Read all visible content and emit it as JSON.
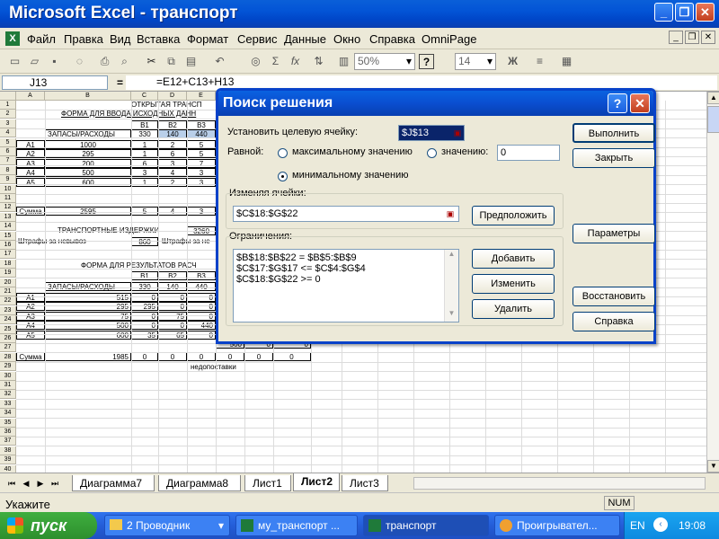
{
  "window": {
    "title": "Microsoft Excel - транспорт"
  },
  "menu": {
    "items": [
      "Файл",
      "Правка",
      "Вид",
      "Вставка",
      "Формат",
      "Сервис",
      "Данные",
      "Окно",
      "Справка",
      "OmniPage"
    ]
  },
  "toolbar": {
    "zoom": "50%",
    "font_size": "14",
    "bold": "Ж",
    "sigma": "Σ",
    "fx": "fx"
  },
  "formula_bar": {
    "name_box": "J13",
    "eq": "=",
    "formula": "=E12+C13+H13"
  },
  "sheet": {
    "columns": [
      "A",
      "B",
      "C",
      "D",
      "E"
    ],
    "rows": [
      "1",
      "2",
      "3",
      "4",
      "5",
      "6",
      "7",
      "8",
      "9",
      "10",
      "11",
      "12",
      "13",
      "14",
      "15",
      "16",
      "17",
      "18",
      "19",
      "20",
      "21",
      "22",
      "23",
      "24",
      "25",
      "26",
      "27",
      "28",
      "29",
      "30",
      "31",
      "32",
      "33",
      "34",
      "35",
      "36",
      "37",
      "38",
      "39",
      "40"
    ],
    "t1": "ОТКРЫТАЯ ТРАНСП",
    "t2": "ФОРМА ДЛЯ ВВОДА ИСХОДНЫХ ДАНН",
    "hdr_b": [
      "B1",
      "B2",
      "B3"
    ],
    "zapasy": "ЗАПАСЫ/РАСХОДЫ",
    "demand": [
      "330",
      "140",
      "440"
    ],
    "rows_a": [
      "A1",
      "A2",
      "A3",
      "A4",
      "A5"
    ],
    "supply": [
      "1000",
      "295",
      "200",
      "500",
      "600"
    ],
    "costs": [
      [
        "1",
        "2",
        "5"
      ],
      [
        "1",
        "6",
        "5"
      ],
      [
        "6",
        "3",
        "7"
      ],
      [
        "3",
        "4",
        "3"
      ],
      [
        "1",
        "2",
        "3"
      ]
    ],
    "sum_label": "Сумма",
    "sum_values": [
      "2595",
      "5",
      "4",
      "3"
    ],
    "transport_costs": "ТРАНСПОРТНЫЕ ИЗДЕРЖКИ",
    "transport_value": "3260",
    "fine_label": "Штрафы за невывоз",
    "fine_value": "860",
    "fine_label2": "Штрафы за не",
    "t3": "ФОРМА ДЛЯ РЕЗУЛЬТАТОВ РАСЧ",
    "res_supply": [
      "515",
      "295",
      "75",
      "500",
      "600"
    ],
    "res": [
      [
        "0",
        "0",
        "0"
      ],
      [
        "295",
        "0",
        "0"
      ],
      [
        "0",
        "75",
        "0"
      ],
      [
        "0",
        "0",
        "440"
      ],
      [
        "35",
        "65",
        "0"
      ]
    ],
    "res_extra": [
      "500",
      "0",
      "0"
    ],
    "res_sum": [
      "1985",
      "0",
      "0",
      "0",
      "0",
      "0",
      "0"
    ],
    "shortage": "недопоставки"
  },
  "tabs": {
    "items": [
      "Диаграмма7",
      "Диаграмма8",
      "Лист1",
      "Лист2",
      "Лист3"
    ],
    "active": "Лист2"
  },
  "status": {
    "text": "Укажите",
    "num": "NUM"
  },
  "taskbar": {
    "start": "пуск",
    "tasks": [
      "2 Проводник",
      "му_транспорт ...",
      "транспорт",
      "Проигрывател..."
    ],
    "lang": "EN",
    "time": "19:08"
  },
  "dialog": {
    "title": "Поиск решения",
    "target_label": "Установить целевую ячейку:",
    "target_value": "$J$13",
    "equal_label": "Равной:",
    "opt_max": "максимальному значению",
    "opt_value": "значению:",
    "value_input": "0",
    "opt_min": "минимальному значению",
    "changing_label": "Изменяя ячейки:",
    "changing_value": "$C$18:$G$22",
    "guess_button": "Предположить",
    "constraints_label": "Ограничения:",
    "constraints": [
      "$B$18:$B$22 = $B$5:$B$9",
      "$C$17:$G$17 <= $C$4:$G$4",
      "$C$18:$G$22 >= 0"
    ],
    "add_button": "Добавить",
    "change_button": "Изменить",
    "delete_button": "Удалить",
    "solve_button": "Выполнить",
    "close_button": "Закрыть",
    "options_button": "Параметры",
    "reset_button": "Восстановить",
    "help_button": "Справка",
    "help_icon": "?",
    "close_icon": "✕"
  }
}
